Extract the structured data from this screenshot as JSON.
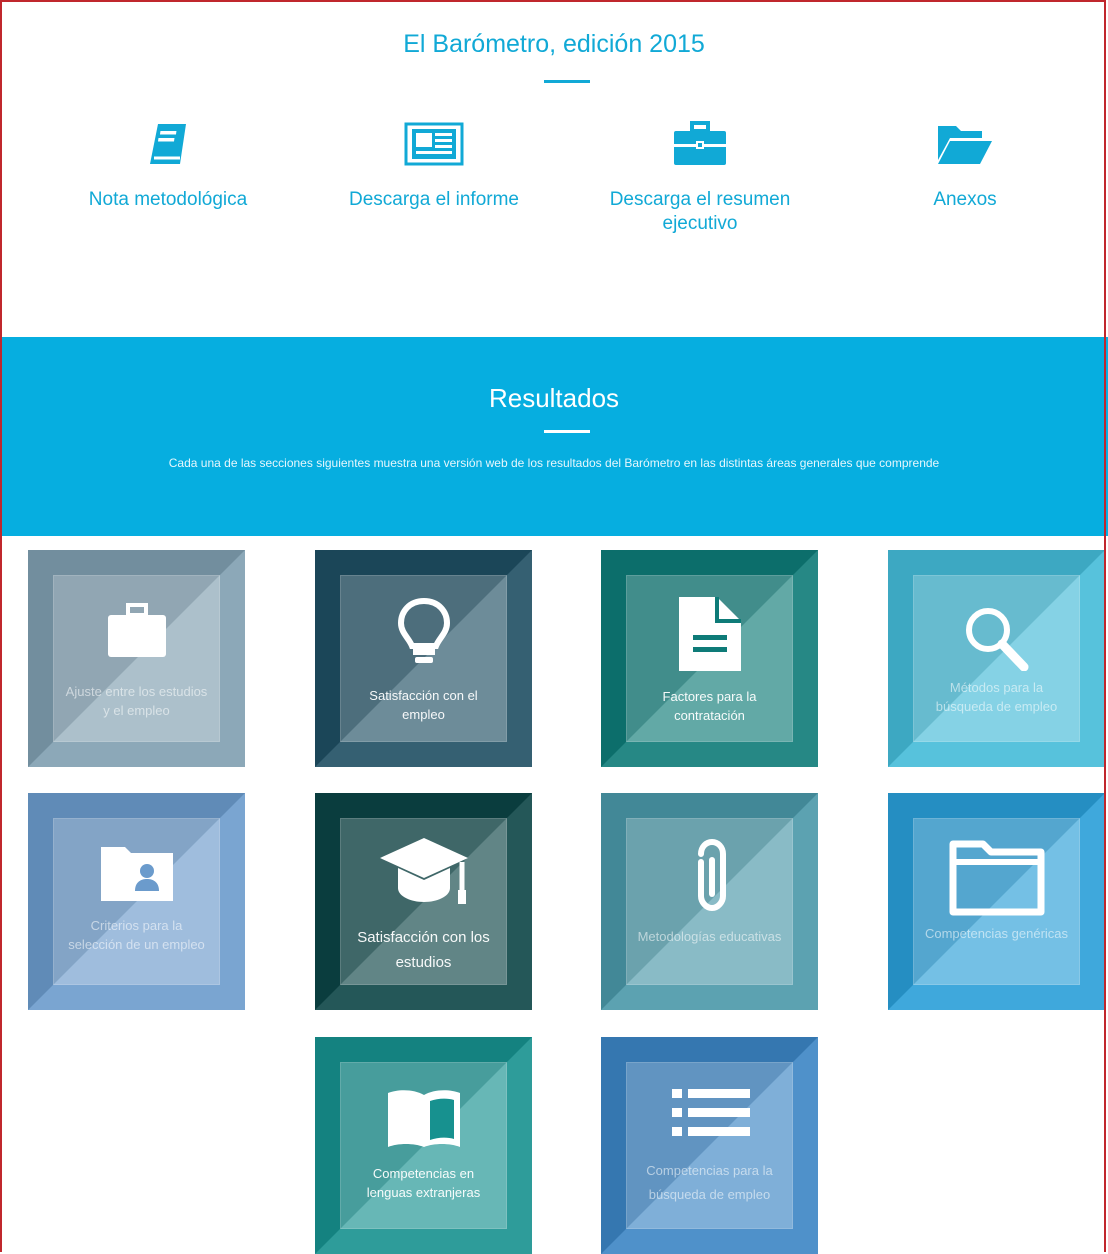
{
  "header": {
    "title": "El Barómetro, edición 2015"
  },
  "downloads": [
    {
      "label": "Nota metodológica",
      "icon": "book-icon"
    },
    {
      "label": "Descarga el informe",
      "icon": "newspaper-icon"
    },
    {
      "label": "Descarga el resumen ejecutivo",
      "icon": "briefcase-icon"
    },
    {
      "label": "Anexos",
      "icon": "folder-open-icon"
    }
  ],
  "results": {
    "title": "Resultados",
    "description": "Cada una de las secciones siguientes muestra una versión web de los resultados del Barómetro en las distintas áreas generales que comprende"
  },
  "tiles": [
    {
      "label": "Ajuste entre los estudios y el empleo",
      "icon": "briefcase-icon",
      "color": "#7f9fb0"
    },
    {
      "label": "Satisfacción con el empleo",
      "icon": "lightbulb-icon",
      "color": "#1f4f62"
    },
    {
      "label": "Factores para la contratación",
      "icon": "document-icon",
      "color": "#0e7b78"
    },
    {
      "label": "Métodos para la búsqueda de empleo",
      "icon": "search-icon",
      "color": "#44bcd9"
    },
    {
      "label": "Criterios para la selección de un empleo",
      "icon": "contact-folder-icon",
      "color": "#6b9bcc"
    },
    {
      "label": "Satisfacción con los estudios",
      "icon": "graduation-cap-icon",
      "color": "#0c4446"
    },
    {
      "label": "Metodologías educativas",
      "icon": "paperclip-icon",
      "color": "#4a98a9"
    },
    {
      "label": "Competencias genéricas",
      "icon": "folder-icon",
      "color": "#2a9fd8"
    },
    {
      "label": "Competencias en lenguas extranjeras",
      "icon": "open-book-icon",
      "color": "#17918f"
    },
    {
      "label": "Competencias para la búsqueda de empleo",
      "icon": "list-icon",
      "color": "#3b85c5"
    }
  ]
}
